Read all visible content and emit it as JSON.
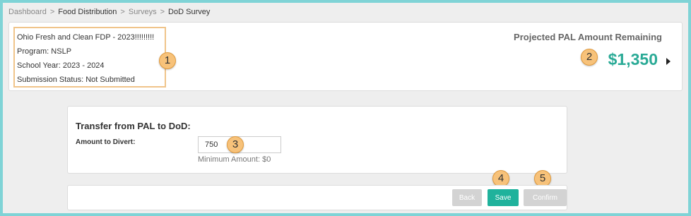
{
  "breadcrumb": {
    "items": [
      "Dashboard",
      "Food Distribution",
      "Surveys",
      "DoD Survey"
    ],
    "separator": ">"
  },
  "info": {
    "name": "Ohio Fresh and Clean FDP - 2023!!!!!!!!!",
    "program": "Program: NSLP",
    "school_year": "School Year: 2023 - 2024",
    "submission_status": "Submission Status: Not Submitted"
  },
  "pal": {
    "label": "Projected PAL Amount Remaining",
    "amount": "$1,350"
  },
  "transfer": {
    "title": "Transfer from PAL to DoD:",
    "amount_label": "Amount to Divert:",
    "amount_value": "750",
    "minimum_hint": "Minimum Amount: $0"
  },
  "actions": {
    "back_label": "Back",
    "save_label": "Save",
    "confirm_label": "Confirm"
  },
  "annotations": [
    "1",
    "2",
    "3",
    "4",
    "5"
  ],
  "colors": {
    "accent": "#1fb29c",
    "amount": "#2aaa96",
    "badge": "#f7c27a",
    "highlight_border": "#f0c48a",
    "outer_border": "#7fd3d6"
  }
}
